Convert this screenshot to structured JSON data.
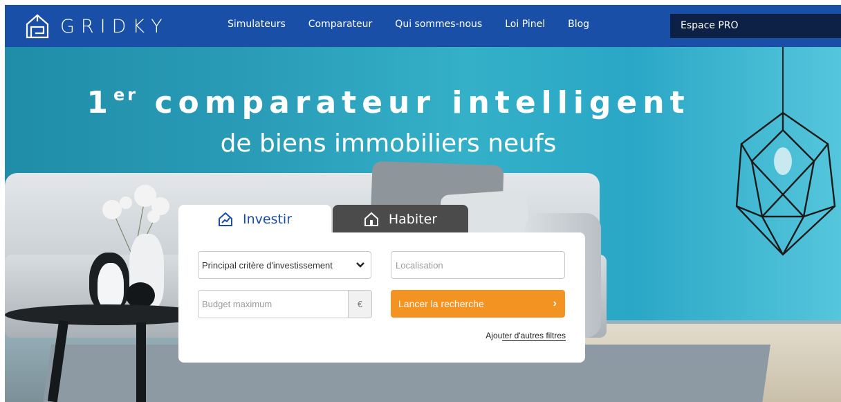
{
  "brand": {
    "name": "GRIDKY",
    "logo_icon": "house-logo-icon"
  },
  "nav": {
    "items": [
      "Simulateurs",
      "Comparateur",
      "Qui sommes-nous",
      "Loi Pinel",
      "Blog"
    ],
    "pro_label": "Espace PRO"
  },
  "hero": {
    "title_ordinal": "1",
    "title_suffix": "er",
    "title_rest": " comparateur intelligent",
    "subtitle": "de biens immobiliers neufs"
  },
  "search": {
    "tabs": {
      "invest": "Investir",
      "habiter": "Habiter",
      "active": "invest"
    },
    "criteria_select": "Principal critère d'investissement",
    "location_placeholder": "Localisation",
    "budget_placeholder": "Budget maximum",
    "currency": "€",
    "submit_label": "Lancer la recherche",
    "submit_arrow": "›",
    "more_filters_prefix": "Ajou",
    "more_filters_underlined": "ter d'autres filtres"
  },
  "colors": {
    "nav": "#1a4fa8",
    "pro": "#0d2146",
    "accent": "#f39322",
    "tab_inactive": "#4b4b4b"
  }
}
